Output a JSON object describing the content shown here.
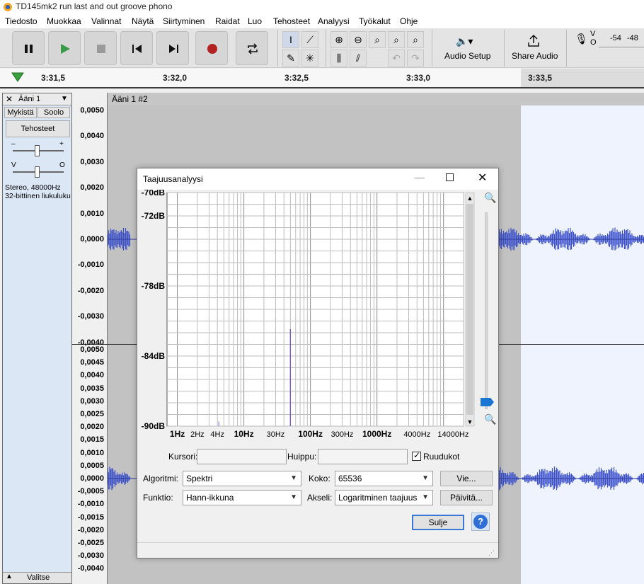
{
  "window": {
    "title": "TD145mk2 run last and out groove phono"
  },
  "menubar": [
    "Tiedosto",
    "Muokkaa",
    "Valinnat",
    "Näytä",
    "Siirtyminen",
    "Raidat",
    "Luo",
    "Tehosteet",
    "Analyysi",
    "Työkalut",
    "Ohje"
  ],
  "toolbar": {
    "audio_setup": "Audio Setup",
    "share_audio": "Share Audio",
    "meter_l": "V",
    "meter_r": "O",
    "meter_ticks": [
      "-54",
      "-48"
    ]
  },
  "timeline": {
    "ticks": [
      "3:31,5",
      "3:32,0",
      "3:32,5",
      "3:33,0",
      "3:33,5"
    ]
  },
  "track": {
    "close": "✕",
    "name": "Ääni 1",
    "mute": "Mykistä",
    "solo": "Soolo",
    "effects": "Tehosteet",
    "gain_minus": "–",
    "gain_plus": "+",
    "pan_left": "V",
    "pan_right": "O",
    "info1": "Stereo, 48000Hz",
    "info2": "32-bittinen liukuluku",
    "select": "Valitse",
    "clip_name": "Ääni 1 #2"
  },
  "vruler_top": [
    "0,0050",
    "0,0040",
    "0,0030",
    "0,0020",
    "0,0010",
    "0,0000",
    "-0,0010",
    "-0,0020",
    "-0,0030",
    "-0,0040"
  ],
  "vruler_bottom": [
    "0,0050",
    "0,0045",
    "0,0040",
    "0,0035",
    "0,0030",
    "0,0025",
    "0,0020",
    "0,0015",
    "0,0010",
    "0,0005",
    "0,0000",
    "-0,0005",
    "-0,0010",
    "-0,0015",
    "-0,0020",
    "-0,0025",
    "-0,0030",
    "-0,0040"
  ],
  "dialog": {
    "title": "Taajuusanalyysi",
    "cursor_label": "Kursori:",
    "cursor_value": "",
    "peak_label": "Huippu:",
    "peak_value": "",
    "grid_label": "Ruudukot",
    "grid_checked": true,
    "algorithm_label": "Algoritmi:",
    "algorithm_value": "Spektri",
    "size_label": "Koko:",
    "size_value": "65536",
    "export_button": "Vie...",
    "function_label": "Funktio:",
    "function_value": "Hann-ikkuna",
    "axis_label": "Akseli:",
    "axis_value": "Logaritminen taajuus",
    "refresh_button": "Päivitä...",
    "close_button": "Sulje",
    "help_button": "?"
  },
  "chart_data": {
    "type": "line",
    "xscale": "log",
    "ylim": [
      -90,
      -70
    ],
    "y_tick_labels": [
      "-70dB",
      "-72dB",
      "-78dB",
      "-84dB",
      "-90dB"
    ],
    "x_tick_labels": [
      "1Hz",
      "2Hz",
      "4Hz",
      "10Hz",
      "30Hz",
      "100Hz",
      "300Hz",
      "1000Hz",
      "4000Hz",
      "14000Hz"
    ],
    "peak": {
      "x": 50,
      "y": -81.7
    },
    "grid": true
  },
  "colors": {
    "spectrum": "#7b5cc4",
    "waveform": "#3b4fc8",
    "waveform_dark": "#2b3aa0",
    "selection": "#eef3fd",
    "help": "#2f6fd6"
  }
}
